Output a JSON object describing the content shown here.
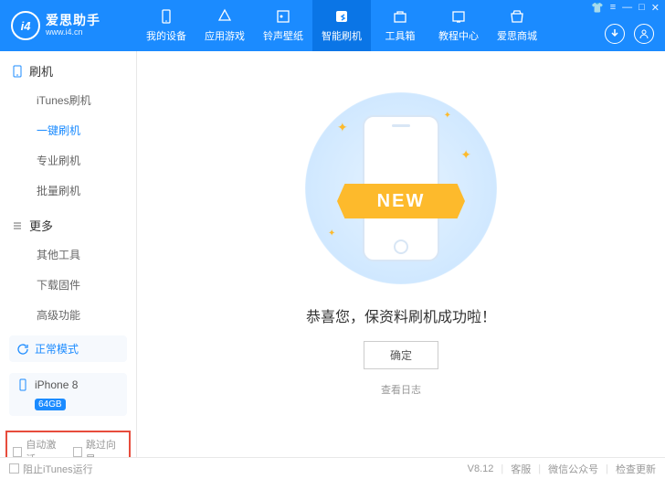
{
  "app": {
    "name": "爱思助手",
    "site": "www.i4.cn",
    "logo_i4": "i4"
  },
  "topTabs": [
    {
      "label": "我的设备",
      "icon": "device"
    },
    {
      "label": "应用游戏",
      "icon": "apps"
    },
    {
      "label": "铃声壁纸",
      "icon": "media"
    },
    {
      "label": "智能刷机",
      "icon": "flash",
      "active": true
    },
    {
      "label": "工具箱",
      "icon": "tools"
    },
    {
      "label": "教程中心",
      "icon": "tutorial"
    },
    {
      "label": "爱思商城",
      "icon": "store"
    }
  ],
  "sidebar": {
    "section1": {
      "title": "刷机",
      "items": [
        "iTunes刷机",
        "一键刷机",
        "专业刷机",
        "批量刷机"
      ],
      "activeIndex": 1
    },
    "section2": {
      "title": "更多",
      "items": [
        "其他工具",
        "下载固件",
        "高级功能"
      ]
    },
    "mode": "正常模式",
    "device": {
      "name": "iPhone 8",
      "storage": "64GB"
    },
    "checks1": {
      "a": "自动激活",
      "b": "跳过向导"
    },
    "checks2": {
      "a": "阻止iTunes运行"
    }
  },
  "main": {
    "ribbon": "NEW",
    "success": "恭喜您，保资料刷机成功啦！",
    "confirm": "确定",
    "logs": "查看日志"
  },
  "footer": {
    "version": "V8.12",
    "links": [
      "客服",
      "微信公众号",
      "检查更新"
    ]
  }
}
